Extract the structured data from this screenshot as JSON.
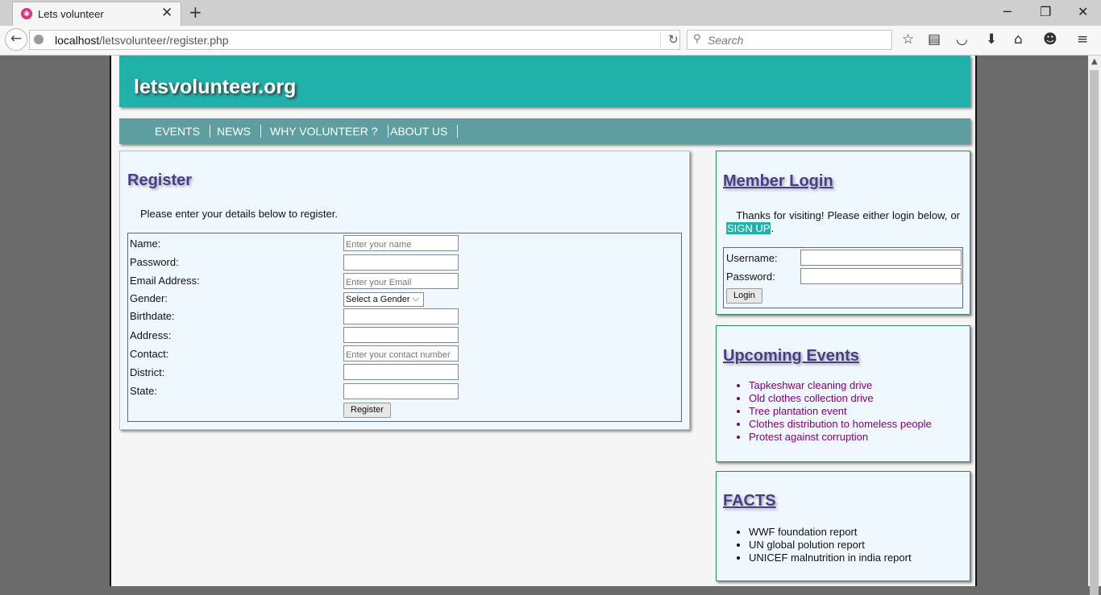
{
  "browser": {
    "tab_title": "Lets volunteer",
    "url_host": "localhost",
    "url_path": "/letsvolunteer/register.php",
    "search_placeholder": "Search"
  },
  "site": {
    "title": "letsvolunteer.org",
    "menu": [
      "EVENTS",
      "NEWS",
      "WHY VOLUNTEER ?",
      "ABOUT US"
    ]
  },
  "register": {
    "heading": "Register",
    "intro": "Please enter your details below to register.",
    "fields": {
      "name_label": "Name:",
      "name_placeholder": "Enter your name",
      "password_label": "Password:",
      "email_label": "Email Address:",
      "email_placeholder": "Enter your Email",
      "gender_label": "Gender:",
      "gender_selected": "Select a Gender",
      "birthdate_label": "Birthdate:",
      "address_label": "Address:",
      "contact_label": "Contact:",
      "contact_placeholder": "Enter your contact number",
      "district_label": "District:",
      "state_label": "State:"
    },
    "submit_label": "Register"
  },
  "login": {
    "heading": "Member Login",
    "text_before": "Thanks for visiting! Please either login below, or ",
    "signup_label": "SIGN UP",
    "text_after": ".",
    "username_label": "Username:",
    "password_label": "Password:",
    "button_label": "Login"
  },
  "events": {
    "heading": "Upcoming Events",
    "items": [
      "Tapkeshwar cleaning drive",
      "Old clothes collection drive",
      "Tree plantation event",
      "Clothes distribution to homeless people",
      "Protest against corruption"
    ]
  },
  "facts": {
    "heading": "FACTS",
    "items": [
      "WWF foundation report",
      "UN global polution report",
      "UNICEF malnutrition in india report"
    ]
  },
  "colors": {
    "header": "#20b2aa",
    "menu": "#5f9ea0",
    "heading": "#483d8b",
    "link_visited": "#800080"
  }
}
